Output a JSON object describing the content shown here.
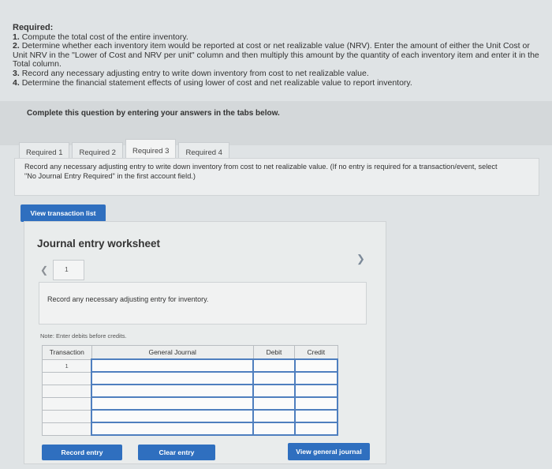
{
  "requirements": {
    "header": "Required:",
    "items": [
      {
        "num": "1.",
        "text": "Compute the total cost of the entire inventory."
      },
      {
        "num": "2.",
        "text": "Determine whether each inventory item would be reported at cost or net realizable value (NRV). Enter the amount of either the Unit Cost or Unit NRV in the \"Lower of Cost and NRV per unit\" column and then multiply this amount by the quantity of each inventory item and enter it in the Total column."
      },
      {
        "num": "3.",
        "text": "Record any necessary adjusting entry to write down inventory from cost to net realizable value."
      },
      {
        "num": "4.",
        "text": "Determine the financial statement effects of using lower of cost and net realizable value to report inventory."
      }
    ]
  },
  "complete_prompt": "Complete this question by entering your answers in the tabs below.",
  "tabs": [
    {
      "label": "Required 1"
    },
    {
      "label": "Required 2"
    },
    {
      "label": "Required 3"
    },
    {
      "label": "Required 4"
    }
  ],
  "instruction": "Record any necessary adjusting entry to write down inventory from cost to net realizable value. (If no entry is required for a transaction/event, select \"No Journal Entry Required\" in the first account field.)",
  "view_transaction_list_label": "View transaction list",
  "worksheet": {
    "title": "Journal entry worksheet",
    "page": "1",
    "entry_description": "Record any necessary adjusting entry for inventory.",
    "note": "Note: Enter debits before credits.",
    "columns": {
      "transaction": "Transaction",
      "general_journal": "General Journal",
      "debit": "Debit",
      "credit": "Credit"
    },
    "transaction_number": "1",
    "record_entry_label": "Record entry",
    "clear_entry_label": "Clear entry",
    "view_general_journal_label": "View general journal"
  },
  "colors": {
    "button_blue": "#2f6fbf",
    "input_border": "#4f7fbf"
  }
}
